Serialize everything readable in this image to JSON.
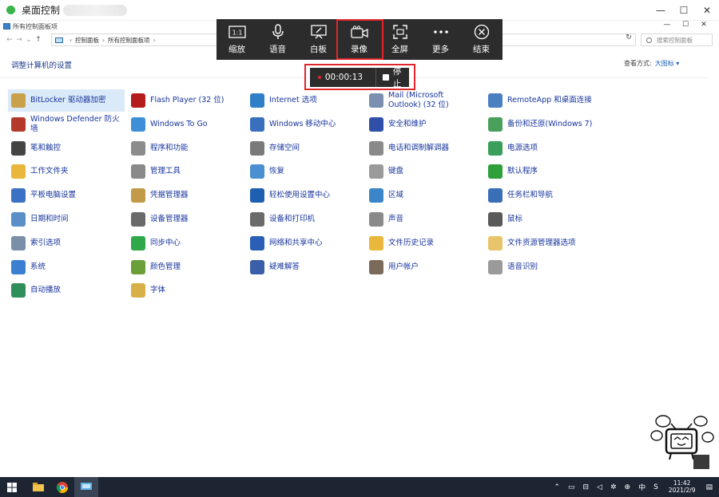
{
  "window": {
    "title": "桌面控制",
    "controls": [
      "—",
      "☐",
      "✕"
    ]
  },
  "explorer": {
    "title": "所有控制面板项",
    "controls": [
      "—",
      "☐",
      "✕"
    ],
    "breadcrumb": [
      "控制面板",
      "所有控制面板项"
    ],
    "search_placeholder": "搜索控制面板"
  },
  "page": {
    "heading": "调整计算机的设置",
    "view_label": "查看方式:",
    "view_value": "大图标 ▾"
  },
  "toolbar": {
    "buttons": [
      {
        "label": "缩放",
        "icon": "zoom-1-1-icon"
      },
      {
        "label": "语音",
        "icon": "microphone-icon"
      },
      {
        "label": "白板",
        "icon": "whiteboard-icon"
      },
      {
        "label": "录像",
        "icon": "video-camera-icon"
      },
      {
        "label": "全屏",
        "icon": "fullscreen-icon"
      },
      {
        "label": "更多",
        "icon": "more-dots-icon"
      },
      {
        "label": "结束",
        "icon": "close-circle-icon"
      }
    ],
    "active_color": "#e0262b",
    "background": "#2c2c2c"
  },
  "recording": {
    "time": "00:00:13",
    "stop_label": "停止"
  },
  "items": [
    [
      "BitLocker 驱动器加密",
      "Windows Defender 防火墙",
      "笔和触控",
      "工作文件夹",
      "平板电脑设置",
      "日期和时间",
      "索引选项",
      "系统",
      "自动播放"
    ],
    [
      "Flash Player (32 位)",
      "Windows To Go",
      "程序和功能",
      "管理工具",
      "凭据管理器",
      "设备管理器",
      "同步中心",
      "颜色管理",
      "字体"
    ],
    [
      "Internet 选项",
      "Windows 移动中心",
      "存储空间",
      "恢复",
      "轻松使用设置中心",
      "设备和打印机",
      "网络和共享中心",
      "疑难解答"
    ],
    [
      "Mail (Microsoft Outlook) (32 位)",
      "安全和维护",
      "电话和调制解调器",
      "键盘",
      "区域",
      "声音",
      "文件历史记录",
      "用户帐户"
    ],
    [
      "RemoteApp 和桌面连接",
      "备份和还原(Windows 7)",
      "电源选项",
      "默认程序",
      "任务栏和导航",
      "鼠标",
      "文件资源管理器选项",
      "语音识别"
    ]
  ],
  "item_colors": [
    [
      "#c8a14a",
      "#b33a2a",
      "#444444",
      "#e8b73b",
      "#3b72c4",
      "#5a8fc8",
      "#7a8fa8",
      "#3a7fd0",
      "#2f8f5a"
    ],
    [
      "#b51d1d",
      "#3f8fd8",
      "#8c8c8c",
      "#8a8a8a",
      "#c29a4a",
      "#6a6a6a",
      "#2fa84a",
      "#6a9f3a",
      "#d8b04a"
    ],
    [
      "#2f7fc8",
      "#3a6fbf",
      "#7a7a7a",
      "#4a8fd0",
      "#1f5fb0",
      "#6a6a6a",
      "#2b5fb5",
      "#3a5fa8"
    ],
    [
      "#7a8fb0",
      "#2f4fa8",
      "#8a8a8a",
      "#9a9a9a",
      "#3a86c8",
      "#8a8a8a",
      "#e8b73b",
      "#7a6a5a"
    ],
    [
      "#4a7fc0",
      "#4a9f5a",
      "#3a9f5a",
      "#2f9f3a",
      "#3a6fb8",
      "#5a5a5a",
      "#e8c46a",
      "#9a9a9a"
    ]
  ],
  "taskbar": {
    "ime": "中",
    "time": "11:42",
    "date": "2021/2/9"
  }
}
